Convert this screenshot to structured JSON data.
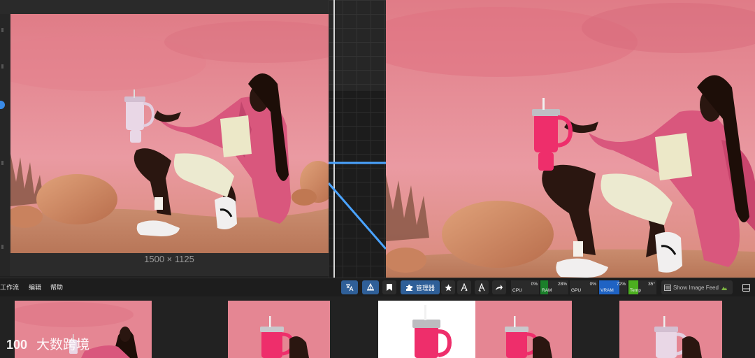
{
  "canvas": {
    "image_size_label": "1500 × 1125"
  },
  "menu": {
    "items": [
      "工作流",
      "编辑",
      "帮助"
    ]
  },
  "toolbar": {
    "manager_label": "管理器",
    "show_feed_label": "Show Image Feed",
    "translate_icon": "translate-icon",
    "scissors_icon": "clipspace-icon"
  },
  "monitors": {
    "cpu": {
      "label": "CPU",
      "value": "0%",
      "fraction": 0.0,
      "color": "#2e7d32"
    },
    "ram": {
      "label": "RAM",
      "value": "28%",
      "fraction": 0.28,
      "color": "#1b7f2a"
    },
    "gpu": {
      "label": "GPU",
      "value": "0%",
      "fraction": 0.0,
      "color": "#2e7d32"
    },
    "vram": {
      "label": "VRAM",
      "value": "72%",
      "fraction": 0.72,
      "color": "#1f63c4"
    },
    "temp": {
      "label": "Temp",
      "value": "35°",
      "fraction": 0.35,
      "color": "#4caf1f"
    }
  },
  "watermark": {
    "logo_text": "100",
    "text": "大数跨境"
  },
  "colors": {
    "accent_blue": "#2f5f98",
    "wire_blue": "#4aa3ff",
    "background_pink": "#e58a93",
    "tumbler_pink": "#ee2e6b"
  }
}
